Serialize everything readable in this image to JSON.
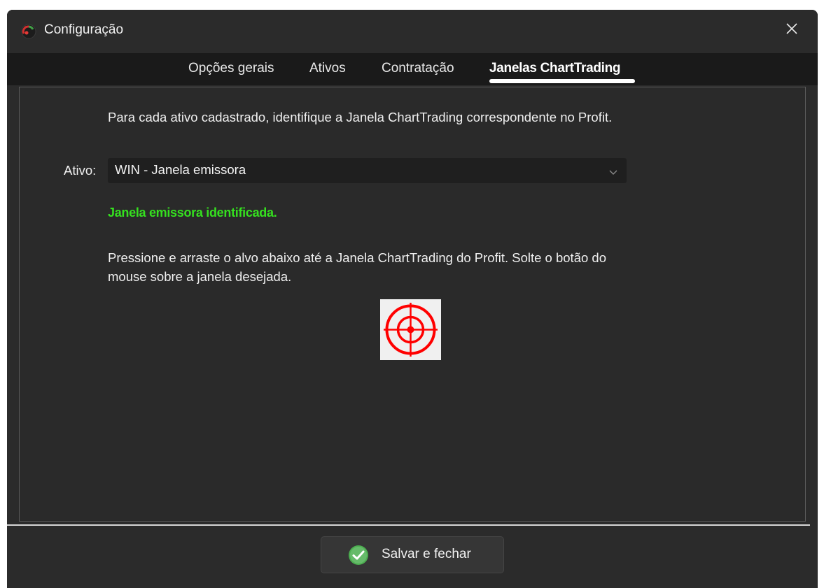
{
  "window": {
    "title": "Configuração",
    "close_icon": "close-icon",
    "app_icon": "app-logo-icon"
  },
  "tabs": [
    {
      "label": "Opções gerais",
      "active": false
    },
    {
      "label": "Ativos",
      "active": false
    },
    {
      "label": "Contratação",
      "active": false
    },
    {
      "label": "Janelas ChartTrading",
      "active": true
    }
  ],
  "panel": {
    "instruction": "Para cada ativo cadastrado, identifique a Janela ChartTrading correspondente no Profit.",
    "asset_label": "Ativo:",
    "asset_selected": "WIN - Janela emissora",
    "status": "Janela emissora identificada.",
    "drag_instruction_line1": "Pressione e arraste o alvo abaixo até a Janela ChartTrading do Profit. Solte o botão do",
    "drag_instruction_line2": "mouse sobre a janela desejada.",
    "target_icon": "crosshair-target-icon"
  },
  "footer": {
    "save_label": "Salvar e fechar",
    "save_icon": "check-circle-icon"
  },
  "colors": {
    "background": "#2b2b2b",
    "tabbar": "#1a1a1a",
    "status_green": "#35e01f",
    "target_red": "#ff0000",
    "check_green": "#4caf50"
  }
}
